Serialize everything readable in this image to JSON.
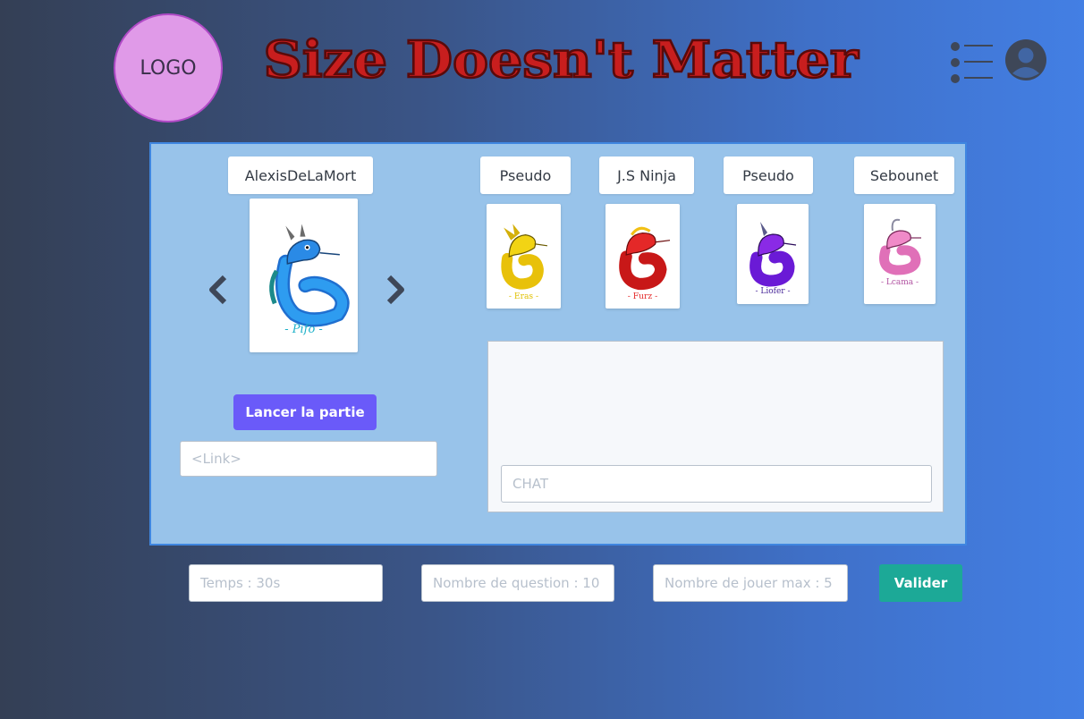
{
  "header": {
    "logo_text": "LOGO",
    "title": "Size Doesn't Matter",
    "title_color": "#c81e1e"
  },
  "players": {
    "host": {
      "name": "AlexisDeLaMort",
      "avatar_caption": "- Pifo -",
      "avatar_color": "#2a8ae6"
    },
    "others": [
      {
        "name": "Pseudo",
        "avatar_caption": "- Eras -",
        "avatar_color": "#f2d414"
      },
      {
        "name": "J.S Ninja",
        "avatar_caption": "- Furz -",
        "avatar_color": "#e42828"
      },
      {
        "name": "Pseudo",
        "avatar_caption": "- Liofer -",
        "avatar_color": "#8a2ae6"
      },
      {
        "name": "Sebounet",
        "avatar_caption": "- Lcama -",
        "avatar_color": "#f08ac8"
      }
    ]
  },
  "actions": {
    "launch_label": "Lancer la partie",
    "link_placeholder": "<Link>",
    "chat_placeholder": "CHAT"
  },
  "settings": {
    "time_placeholder": "Temps : 30s",
    "questions_placeholder": "Nombre de question : 10",
    "max_players_placeholder": "Nombre de jouer max : 5",
    "validate_label": "Valider"
  }
}
